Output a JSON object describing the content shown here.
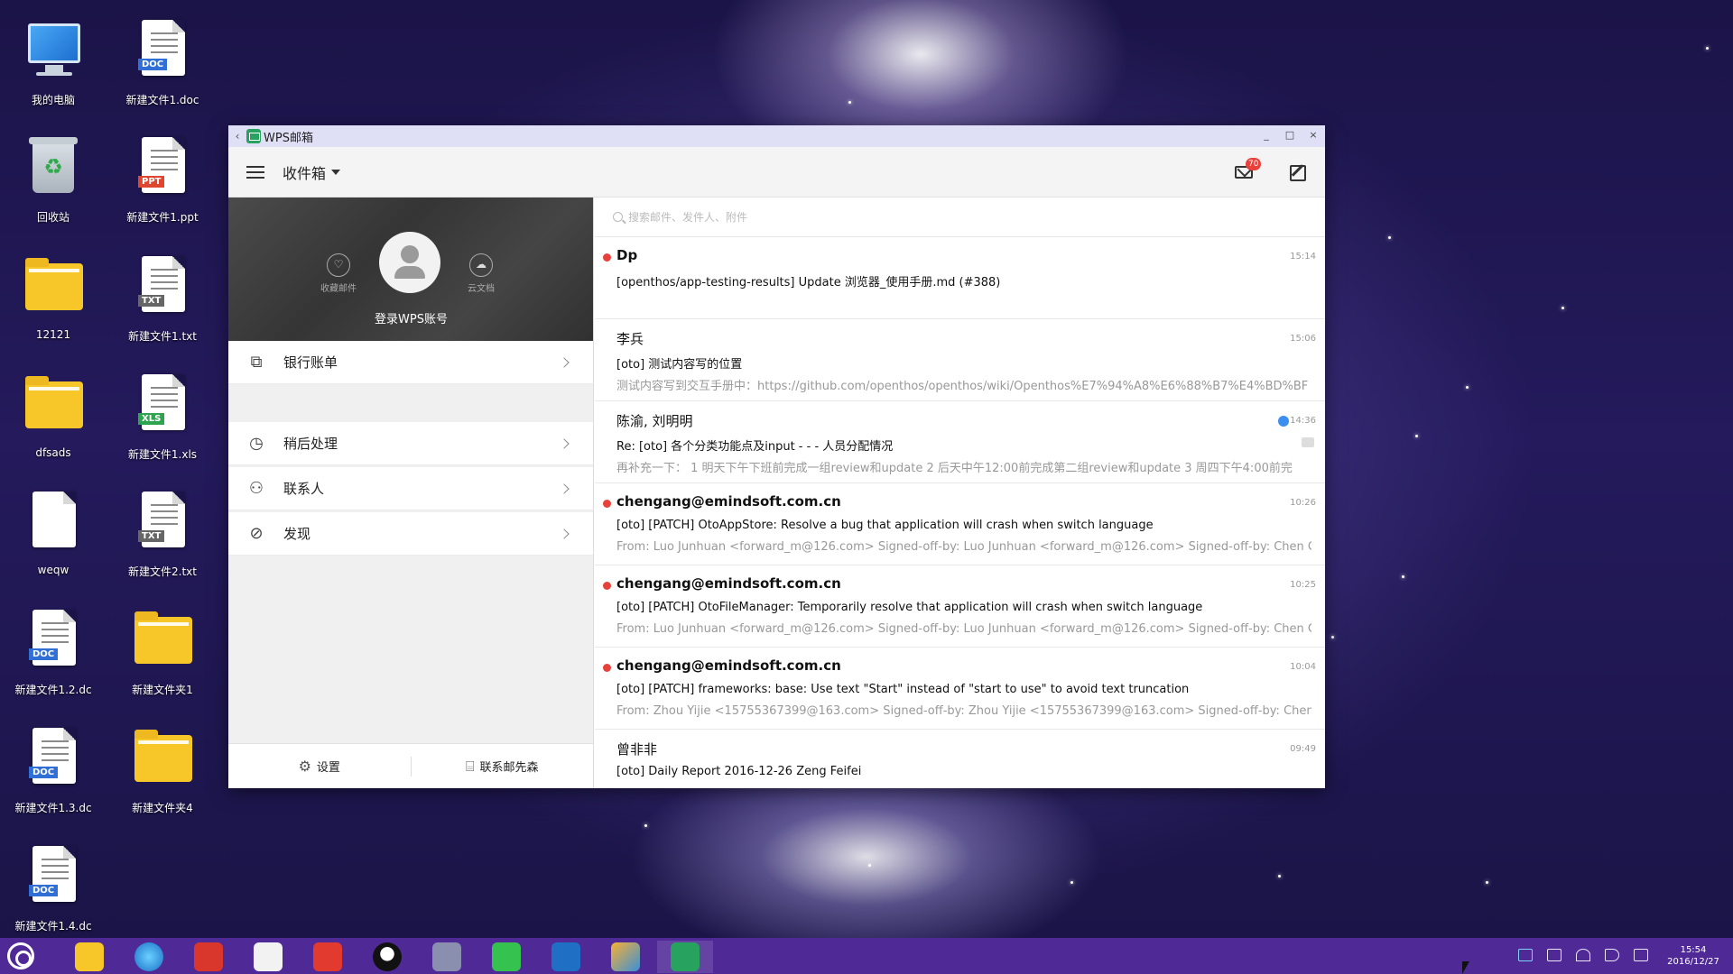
{
  "desktop": {
    "icons": [
      {
        "label": "我的电脑",
        "kind": "computer"
      },
      {
        "label": "新建文件1.doc",
        "kind": "doc",
        "tag": "DOC"
      },
      {
        "label": "回收站",
        "kind": "recycle"
      },
      {
        "label": "新建文件1.ppt",
        "kind": "doc",
        "tag": "PPT"
      },
      {
        "label": "12121",
        "kind": "folder"
      },
      {
        "label": "新建文件1.txt",
        "kind": "doc",
        "tag": "TXT"
      },
      {
        "label": "dfsads",
        "kind": "folder"
      },
      {
        "label": "新建文件1.xls",
        "kind": "doc",
        "tag": "XLS"
      },
      {
        "label": "weqw",
        "kind": "blank"
      },
      {
        "label": "新建文件2.txt",
        "kind": "doc",
        "tag": "TXT"
      },
      {
        "label": "新建文件1.2.dc",
        "kind": "doc",
        "tag": "DOC"
      },
      {
        "label": "新建文件夹1",
        "kind": "folder"
      },
      {
        "label": "新建文件1.3.dc",
        "kind": "doc",
        "tag": "DOC"
      },
      {
        "label": "新建文件夹4",
        "kind": "folder"
      },
      {
        "label": "新建文件1.4.dc",
        "kind": "doc",
        "tag": "DOC"
      }
    ]
  },
  "window": {
    "title": "WPS邮箱",
    "folder": "收件箱",
    "unread_badge": "70",
    "profile": {
      "login_label": "登录WPS账号",
      "favorites_label": "收藏邮件",
      "cloud_label": "云文档"
    },
    "menu": {
      "bank_bills": "银行账单",
      "later": "稍后处理",
      "contacts": "联系人",
      "discover": "发现"
    },
    "footer": {
      "settings": "设置",
      "contact_mr": "联系邮先森"
    },
    "search_placeholder": "搜索邮件、发件人、附件",
    "mails": [
      {
        "sender": "Dp",
        "time": "15:14",
        "subject": "[openthos/app-testing-results] Update 浏览器_使用手册.md (#388)",
        "preview": "",
        "unread": true
      },
      {
        "sender": "李兵",
        "time": "15:06",
        "subject": "[oto] 测试内容写的位置",
        "preview": "测试内容写到交互手册中：https://github.com/openthos/openthos/wiki/Openthos%E7%94%A8%E6%88%B7%E4%BD%BF",
        "unread": false
      },
      {
        "sender": "陈渝, 刘明明",
        "time": "14:36",
        "subject": "Re: [oto] 各个分类功能点及input - - - 人员分配情况",
        "preview": "再补充一下： 1 明天下午下班前完成一组review和update 2 后天中午12:00前完成第二组review和update 3 周四下午4:00前完",
        "unread": false
      },
      {
        "sender": "chengang@emindsoft.com.cn",
        "time": "10:26",
        "subject": "[oto] [PATCH] OtoAppStore: Resolve a bug that application will crash when switch language",
        "preview": "From: Luo Junhuan <forward_m@126.com> Signed-off-by: Luo Junhuan <forward_m@126.com> Signed-off-by: Chen Gang",
        "unread": true
      },
      {
        "sender": "chengang@emindsoft.com.cn",
        "time": "10:25",
        "subject": "[oto] [PATCH] OtoFileManager: Temporarily resolve that application will crash when switch language",
        "preview": "From: Luo Junhuan <forward_m@126.com> Signed-off-by: Luo Junhuan <forward_m@126.com> Signed-off-by: Chen Gang",
        "unread": true
      },
      {
        "sender": "chengang@emindsoft.com.cn",
        "time": "10:04",
        "subject": "[oto] [PATCH] frameworks: base: Use text \"Start\" instead of \"start to use\" to avoid text truncation",
        "preview": "From: Zhou Yijie <15755367399@163.com> Signed-off-by: Zhou Yijie <15755367399@163.com> Signed-off-by: Chen Gang",
        "unread": true
      },
      {
        "sender": "曾非非",
        "time": "09:49",
        "subject": "[oto] Daily Report 2016-12-26 Zeng Feifei",
        "preview": "",
        "unread": false
      }
    ]
  },
  "taskbar": {
    "apps": [
      "file-manager",
      "browser",
      "wps-office",
      "drawing-app",
      "jd-store",
      "qq",
      "game-app",
      "wechat",
      "outlook",
      "mail-app",
      "wps-mail"
    ],
    "clock_time": "15:54",
    "clock_date": "2016/12/27"
  },
  "colors": {
    "taskbar": "#4f2a97",
    "titlebar": "#dfe0f5",
    "unread_dot": "#e8413c",
    "folder": "#f7c629"
  }
}
